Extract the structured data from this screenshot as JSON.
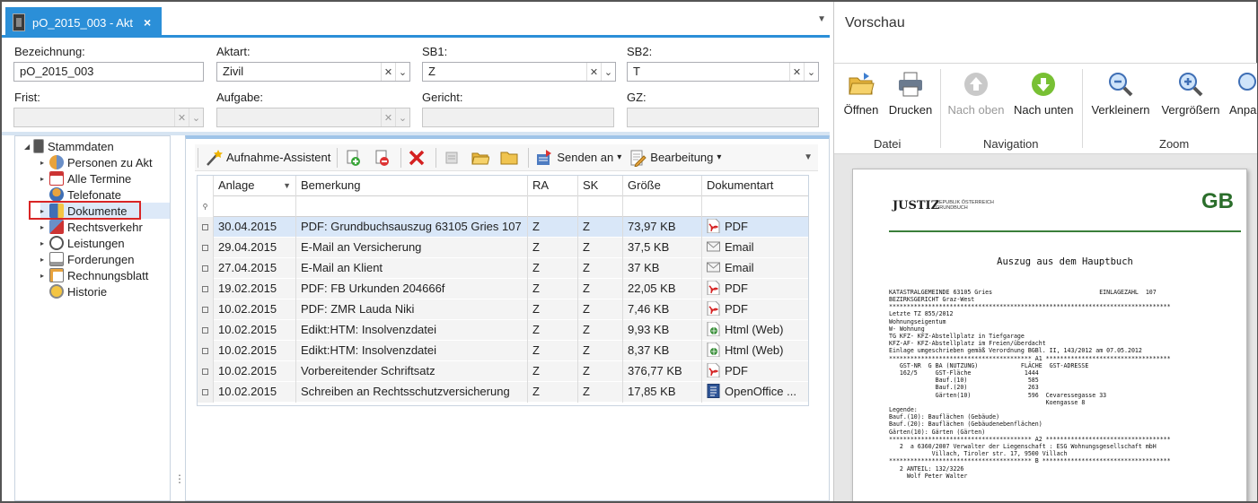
{
  "tab": {
    "title": "pO_2015_003 - Akt",
    "close": "×",
    "menu": "▼"
  },
  "form": {
    "bezeichnung": {
      "label": "Bezeichnung:",
      "value": "pO_2015_003"
    },
    "aktart": {
      "label": "Aktart:",
      "value": "Zivil"
    },
    "sb1": {
      "label": "SB1:",
      "value": "Z"
    },
    "sb2": {
      "label": "SB2:",
      "value": "T"
    },
    "frist": {
      "label": "Frist:",
      "value": ""
    },
    "aufgabe": {
      "label": "Aufgabe:",
      "value": ""
    },
    "gericht": {
      "label": "Gericht:",
      "value": ""
    },
    "gz": {
      "label": "GZ:",
      "value": ""
    },
    "clear_glyph": "✕",
    "drop_glyph": "⌄"
  },
  "tree": {
    "root": "Stammdaten",
    "items": [
      {
        "label": "Personen zu Akt",
        "icon": "people-icon"
      },
      {
        "label": "Alle Termine",
        "icon": "calendar-icon"
      },
      {
        "label": "Telefonate",
        "icon": "phone-icon"
      },
      {
        "label": "Dokumente",
        "icon": "documents-icon"
      },
      {
        "label": "Rechtsverkehr",
        "icon": "legal-traffic-icon"
      },
      {
        "label": "Leistungen",
        "icon": "clock-icon"
      },
      {
        "label": "Forderungen",
        "icon": "claims-icon"
      },
      {
        "label": "Rechnungsblatt",
        "icon": "invoice-icon"
      },
      {
        "label": "Historie",
        "icon": "history-icon"
      }
    ],
    "selected": "Dokumente",
    "grip": "⋮"
  },
  "toolbar": {
    "assistant": "Aufnahme-Assistent",
    "send": "Senden an",
    "edit": "Bearbeitung",
    "dropdown": "▾",
    "more": "▼"
  },
  "grid": {
    "headers": [
      "Anlage",
      "Bemerkung",
      "RA",
      "SK",
      "Größe",
      "Dokumentart"
    ],
    "filter_glyph": "▼",
    "sort_glyph": "▼",
    "rows": [
      {
        "anlage": "30.04.2015",
        "bemerkung": "PDF: Grundbuchsauszug 63105 Gries 107",
        "ra": "Z",
        "sk": "Z",
        "groesse": "73,97 KB",
        "art": "PDF",
        "icon": "pdf"
      },
      {
        "anlage": "29.04.2015",
        "bemerkung": "E-Mail an Versicherung",
        "ra": "Z",
        "sk": "Z",
        "groesse": "37,5 KB",
        "art": "Email",
        "icon": "email"
      },
      {
        "anlage": "27.04.2015",
        "bemerkung": "E-Mail an Klient",
        "ra": "Z",
        "sk": "Z",
        "groesse": "37 KB",
        "art": "Email",
        "icon": "email"
      },
      {
        "anlage": "19.02.2015",
        "bemerkung": "PDF: FB Urkunden 204666f",
        "ra": "Z",
        "sk": "Z",
        "groesse": "22,05 KB",
        "art": "PDF",
        "icon": "pdf"
      },
      {
        "anlage": "10.02.2015",
        "bemerkung": "PDF: ZMR Lauda Niki",
        "ra": "Z",
        "sk": "Z",
        "groesse": "7,46 KB",
        "art": "PDF",
        "icon": "pdf"
      },
      {
        "anlage": "10.02.2015",
        "bemerkung": "Edikt:HTM: Insolvenzdatei",
        "ra": "Z",
        "sk": "Z",
        "groesse": "9,93 KB",
        "art": "Html (Web)",
        "icon": "html"
      },
      {
        "anlage": "10.02.2015",
        "bemerkung": "Edikt:HTM: Insolvenzdatei",
        "ra": "Z",
        "sk": "Z",
        "groesse": "8,37 KB",
        "art": "Html (Web)",
        "icon": "html"
      },
      {
        "anlage": "10.02.2015",
        "bemerkung": "Vorbereitender Schriftsatz",
        "ra": "Z",
        "sk": "Z",
        "groesse": "376,77 KB",
        "art": "PDF",
        "icon": "pdf"
      },
      {
        "anlage": "10.02.2015",
        "bemerkung": "Schreiben an Rechtsschutzversicherung",
        "ra": "Z",
        "sk": "Z",
        "groesse": "17,85 KB",
        "art": "OpenOffice ...",
        "icon": "openoffice"
      }
    ],
    "selected_row": 0
  },
  "preview": {
    "title": "Vorschau",
    "buttons": {
      "open": "Öffnen",
      "print": "Drucken",
      "up": "Nach oben",
      "down": "Nach unten",
      "zoom_out": "Verkleinern",
      "zoom_in": "Vergrößern",
      "fit": "Anpa"
    },
    "groups": {
      "file": "Datei",
      "navigation": "Navigation",
      "zoom": "Zoom"
    },
    "doc": {
      "logo": "JUSTIZ",
      "logo_sub": "REPUBLIK ÖSTERREICH GRUNDBUCH",
      "mark": "GB",
      "heading": "Auszug aus dem Hauptbuch",
      "lines": [
        "KATASTRALGEMEINDE 63105 Gries                              EINLAGEZAHL  107",
        "BEZIRKSGERICHT Graz-West",
        "*******************************************************************************",
        "Letzte TZ 855/2012",
        "Wohnungseigentum",
        "W- Wohnung",
        "TG KFZ- KFZ-Abstellplatz in Tiefgarage",
        "KFZ-AF- KFZ-Abstellplatz im Freien/überdacht",
        "Einlage umgeschrieben gemäß Verordnung BGBl. II, 143/2012 am 07.05.2012",
        "**************************************** A1 ***********************************",
        "   GST-NR  G BA (NUTZUNG)            FLÄCHE  GST-ADRESSE",
        "   162/5     GST-Fläche               1444",
        "             Bauf.(10)                 585",
        "             Bauf.(20)                 263",
        "             Gärten(10)                596  Cevaressegasse 33",
        "                                            Koengasse 8",
        "Legende:",
        "Bauf.(10): Bauflächen (Gebäude)",
        "Bauf.(20): Bauflächen (Gebäudenebenflächen)",
        "Gärten(10): Gärten (Gärten)",
        "**************************************** A2 ***********************************",
        "   2  a 6360/2007 Verwalter der Liegenschaft : ESG Wohnungsgesellschaft mbH",
        "            Villach, Tiroler str. 17, 9500 Villach",
        "**************************************** B ************************************",
        "   2 ANTEIL: 132/3226",
        "     Wolf Peter Walter"
      ]
    }
  },
  "colors": {
    "accent": "#2b8fd8",
    "selection": "#d9e7f8",
    "highlight": "#d92525",
    "gb_green": "#2b6e2b"
  }
}
